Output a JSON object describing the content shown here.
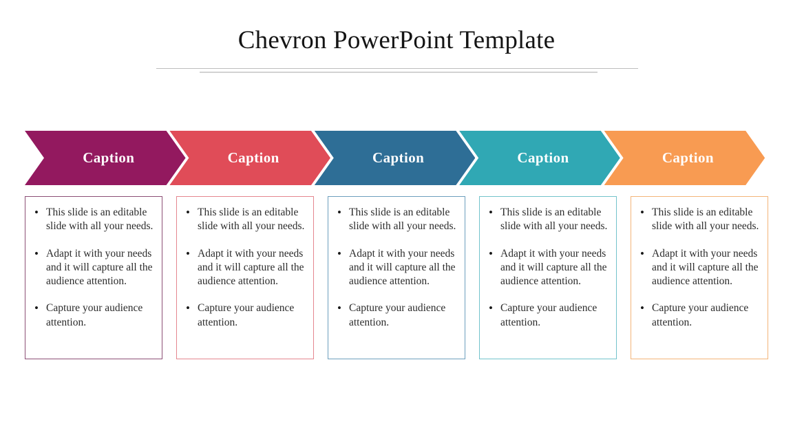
{
  "slide": {
    "title": "Chevron PowerPoint Template",
    "background_color": "#FFFFFF",
    "divider_long_color": "#BDBDBD",
    "divider_short_color": "#D2D2D2"
  },
  "steps": [
    {
      "caption": "Caption",
      "color": "#93195F",
      "border_color": "#8C4E75",
      "bullets": [
        "This slide is an editable slide with all your needs.",
        "Adapt it with your needs and it will capture all the audience attention.",
        "Capture your audience attention."
      ]
    },
    {
      "caption": "Caption",
      "color": "#E04C58",
      "border_color": "#E4868F",
      "bullets": [
        "This slide is an editable slide with all your needs.",
        "Adapt it with your needs and it will capture all the audience attention.",
        "Capture your audience attention."
      ]
    },
    {
      "caption": "Caption",
      "color": "#2E6E96",
      "border_color": "#6C9FBD",
      "bullets": [
        "This slide is an editable slide with all your needs.",
        "Adapt it with your needs and it will capture all the audience attention.",
        "Capture your audience attention."
      ]
    },
    {
      "caption": "Caption",
      "color": "#30A8B4",
      "border_color": "#72C3CB",
      "bullets": [
        "This slide is an editable slide with all your needs.",
        "Adapt it with your needs and it will capture all the audience attention.",
        "Capture your audience attention."
      ]
    },
    {
      "caption": "Caption",
      "color": "#F89B52",
      "border_color": "#F3B478",
      "bullets": [
        "This slide is an editable slide with all your needs.",
        "Adapt it with your needs and it will capture all the audience attention.",
        "Capture your audience attention."
      ]
    }
  ],
  "bullet_glyph": "•"
}
